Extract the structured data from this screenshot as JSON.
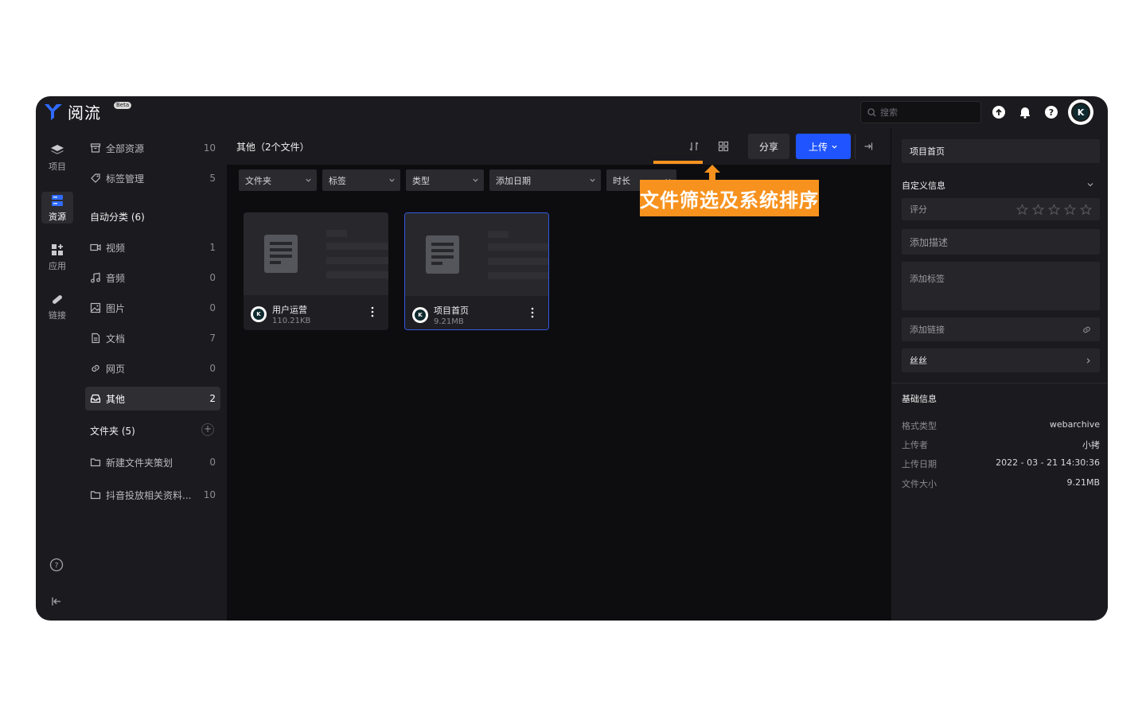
{
  "app": {
    "name": "阅流",
    "badge": "Beta"
  },
  "search": {
    "placeholder": "搜索"
  },
  "avatar_letter": "K",
  "rail": [
    {
      "label": "项目",
      "icon": "layers-icon"
    },
    {
      "label": "资源",
      "icon": "resource-icon"
    },
    {
      "label": "应用",
      "icon": "apps-icon"
    },
    {
      "label": "链接",
      "icon": "link-icon"
    }
  ],
  "sidebar": {
    "top": [
      {
        "label": "全部资源",
        "count": "10",
        "icon": "archive-icon"
      },
      {
        "label": "标签管理",
        "count": "5",
        "icon": "tag-icon"
      }
    ],
    "auto_heading": "自动分类 (6)",
    "auto": [
      {
        "label": "视频",
        "count": "1",
        "icon": "video-icon"
      },
      {
        "label": "音频",
        "count": "0",
        "icon": "music-icon"
      },
      {
        "label": "图片",
        "count": "0",
        "icon": "image-icon"
      },
      {
        "label": "文档",
        "count": "7",
        "icon": "document-icon"
      },
      {
        "label": "网页",
        "count": "0",
        "icon": "link-icon"
      },
      {
        "label": "其他",
        "count": "2",
        "icon": "inbox-icon"
      }
    ],
    "folder_heading": "文件夹 (5)",
    "folders": [
      {
        "label": "新建文件夹策划",
        "count": "0",
        "icon": "folder-icon"
      },
      {
        "label": "抖音投放相关资料...",
        "count": "10",
        "icon": "folder-icon"
      }
    ]
  },
  "main": {
    "title": "其他（2个文件）",
    "share_label": "分享",
    "upload_label": "上传",
    "filters": [
      "文件夹",
      "标签",
      "类型",
      "添加日期",
      "时长"
    ],
    "files": [
      {
        "name": "用户运营",
        "size": "110.21KB"
      },
      {
        "name": "项目首页",
        "size": "9.21MB"
      }
    ]
  },
  "annotation": {
    "text": "文件筛选及系统排序"
  },
  "detail": {
    "title": "项目首页",
    "custom_heading": "自定义信息",
    "rating_label": "评分",
    "desc_placeholder": "添加描述",
    "tags_placeholder": "添加标签",
    "link_placeholder": "添加链接",
    "extra_item": "丝丝",
    "basic_heading": "基础信息",
    "info": [
      {
        "k": "格式类型",
        "v": "webarchive"
      },
      {
        "k": "上传者",
        "v": "小拷"
      },
      {
        "k": "上传日期",
        "v": "2022 - 03 - 21 14:30:36"
      },
      {
        "k": "文件大小",
        "v": "9.21MB"
      }
    ]
  },
  "colors": {
    "accent": "#1f54ff",
    "annotation": "#f7921e",
    "selected_border": "#3559e0"
  }
}
